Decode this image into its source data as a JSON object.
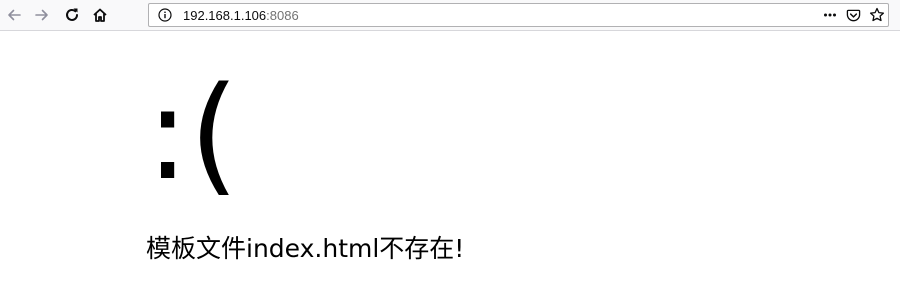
{
  "browser": {
    "url_host": "192.168.1.106",
    "url_port": ":8086"
  },
  "page": {
    "face": ":(",
    "message": "模板文件index.html不存在!"
  }
}
